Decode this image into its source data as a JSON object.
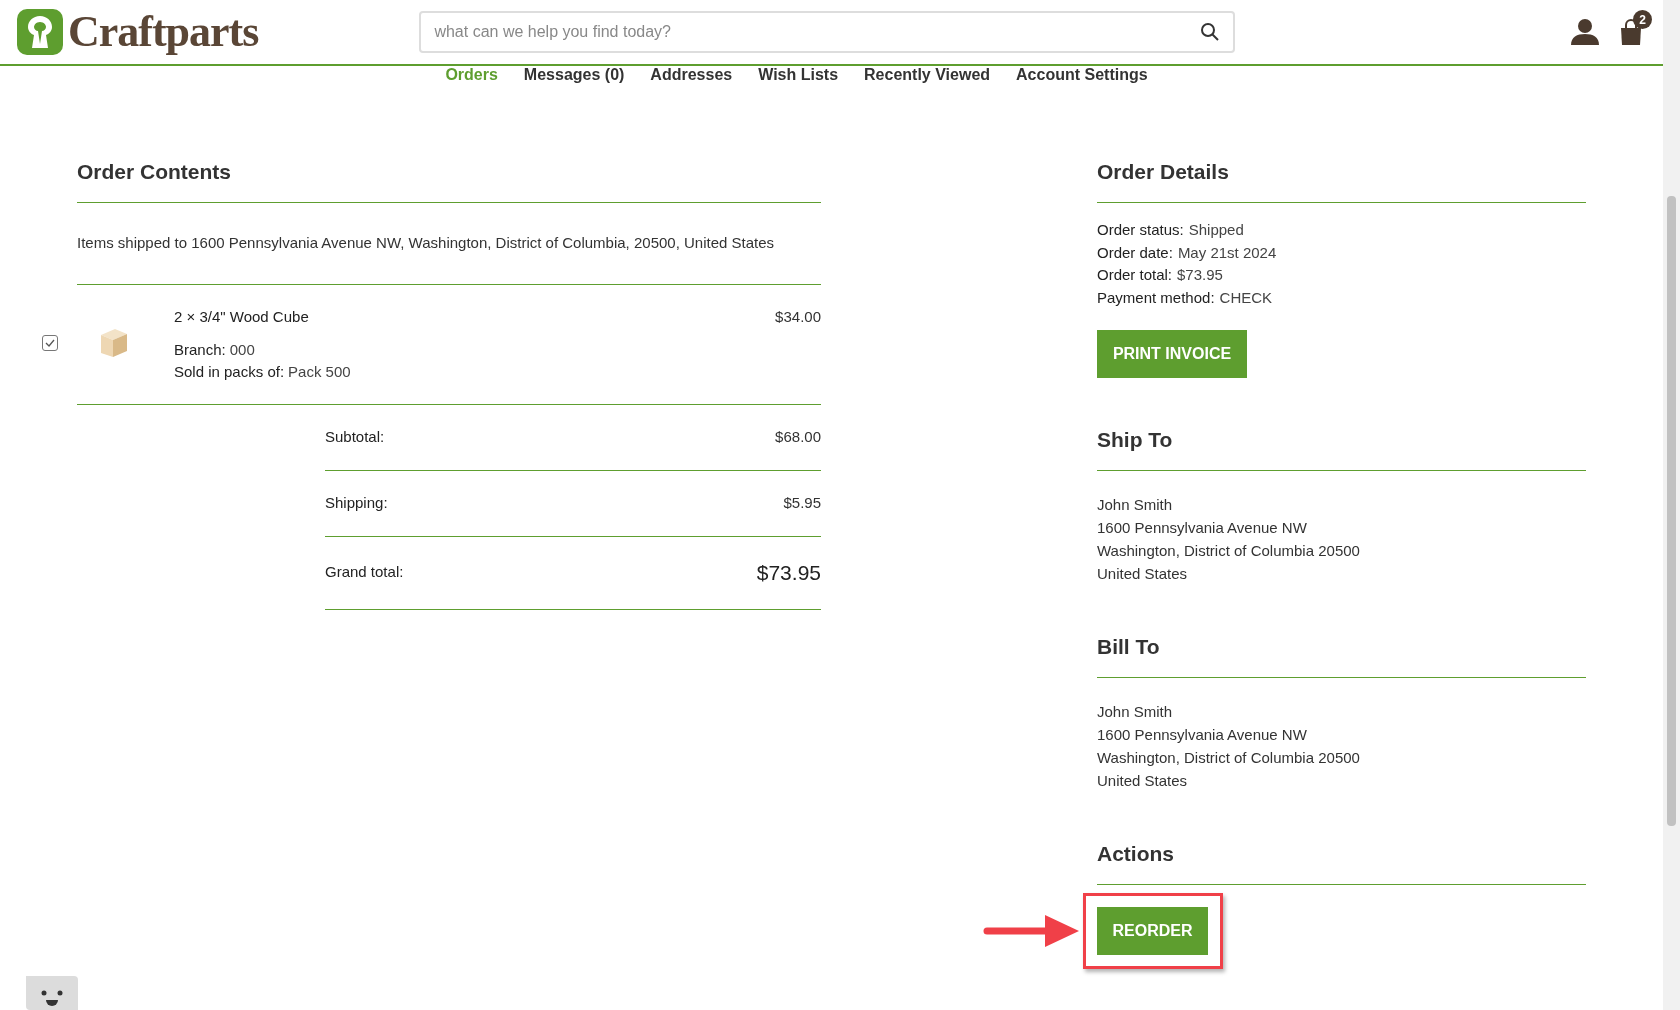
{
  "header": {
    "logo": "Craftparts",
    "search": {
      "placeholder": "what can we help you find today?"
    },
    "cart_count": "2"
  },
  "nav": [
    {
      "label": "Orders",
      "selected": true
    },
    {
      "label": "Messages (0)",
      "selected": false
    },
    {
      "label": "Addresses",
      "selected": false
    },
    {
      "label": "Wish Lists",
      "selected": false
    },
    {
      "label": "Recently Viewed",
      "selected": false
    },
    {
      "label": "Account Settings",
      "selected": false
    }
  ],
  "order_contents": {
    "title": "Order Contents",
    "shipped_to": "Items shipped to 1600 Pennsylvania Avenue NW, Washington, District of Columbia, 20500, United States",
    "items": [
      {
        "checked": true,
        "name": "2 × 3/4\" Wood Cube",
        "price": "$34.00",
        "details": [
          {
            "label": "Branch:",
            "value": "000"
          },
          {
            "label": "Sold in packs of:",
            "value": "Pack 500"
          }
        ]
      }
    ],
    "totals": [
      {
        "kind": "normal",
        "label": "Subtotal:",
        "value": "$68.00"
      },
      {
        "kind": "normal",
        "label": "Shipping:",
        "value": "$5.95"
      },
      {
        "kind": "grand",
        "label": "Grand total:",
        "value": "$73.95"
      }
    ]
  },
  "order_details": {
    "title": "Order Details",
    "fields": [
      {
        "label": "Order status:",
        "value": "Shipped"
      },
      {
        "label": "Order date:",
        "value": "May 21st 2024"
      },
      {
        "label": "Order total:",
        "value": "$73.95"
      },
      {
        "label": "Payment method:",
        "value": "CHECK"
      }
    ],
    "button": "PRINT INVOICE"
  },
  "ship_to": {
    "title": "Ship To",
    "lines": [
      "John Smith",
      "1600 Pennsylvania Avenue NW",
      "Washington, District of Columbia 20500",
      "United States"
    ]
  },
  "bill_to": {
    "title": "Bill To",
    "lines": [
      "John Smith",
      "1600 Pennsylvania Avenue NW",
      "Washington, District of Columbia 20500",
      "United States"
    ]
  },
  "actions": {
    "title": "Actions",
    "button": "REORDER",
    "highlighted": true
  }
}
